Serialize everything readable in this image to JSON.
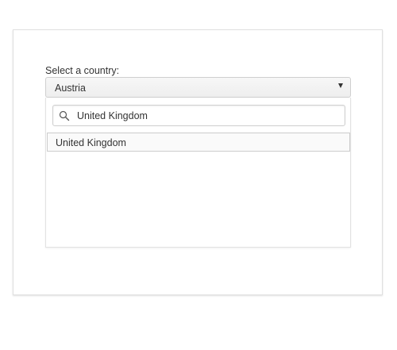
{
  "form": {
    "label": "Select a country:",
    "select": {
      "selected_value": "Austria"
    },
    "dropdown": {
      "search": {
        "value": "United Kingdom",
        "placeholder": ""
      },
      "results": [
        "United Kingdom"
      ]
    }
  },
  "icons": {
    "search": "search-icon",
    "dropdown_arrow": "caret-down-icon"
  },
  "colors": {
    "text": "#333333",
    "border": "#cfcfcf",
    "select_bg": "#eeeeee",
    "highlight_border": "#cccccc"
  }
}
